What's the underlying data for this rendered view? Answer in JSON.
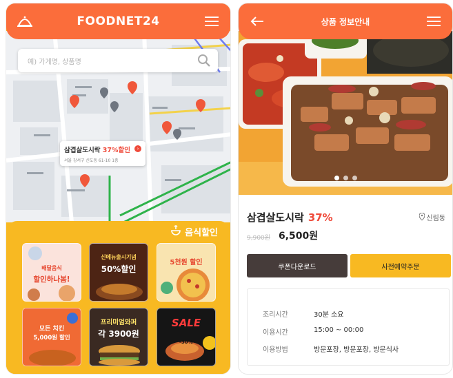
{
  "left_screen": {
    "brand": "FOODNET24",
    "search_placeholder": "예) 가게명, 상품명",
    "map_popup": {
      "title": "삼겹살도시락",
      "discount": "37%할인",
      "address": "서울 강서구 신도동 61-10 1층"
    },
    "promo_section": {
      "title": "음식할인",
      "tiles": [
        {
          "line1": "배달음식",
          "line2": "할인하나봄!"
        },
        {
          "line1": "신메뉴출시기념",
          "line2": "50%할인"
        },
        {
          "line1": "5천원 할인",
          "line2": ""
        },
        {
          "line1": "모든 치킨",
          "line2": "5,000원 할인"
        },
        {
          "line1": "프리미엄와퍼",
          "line2": "각 3900원"
        },
        {
          "line1": "SALE",
          "line2": "-50%"
        }
      ]
    }
  },
  "right_screen": {
    "title": "상품 정보안내",
    "product_name": "삼겹살도시락",
    "discount": "37%",
    "location": "신림동",
    "original_price": "9,900원",
    "price": "6,500원",
    "buttons": {
      "coupon": "쿠폰다운로드",
      "preorder": "사전예약주문"
    },
    "info": [
      {
        "label": "조리시간",
        "value": "30분 소요"
      },
      {
        "label": "이용시간",
        "value": "15:00 ~ 00:00"
      },
      {
        "label": "이용방법",
        "value": "방문포장, 방문포장, 방문식사"
      }
    ]
  },
  "colors": {
    "accent_orange": "#fb6d3b",
    "promo_yellow": "#f8b922",
    "dark_button": "#463c3a",
    "discount_red": "#ef4a3a"
  }
}
